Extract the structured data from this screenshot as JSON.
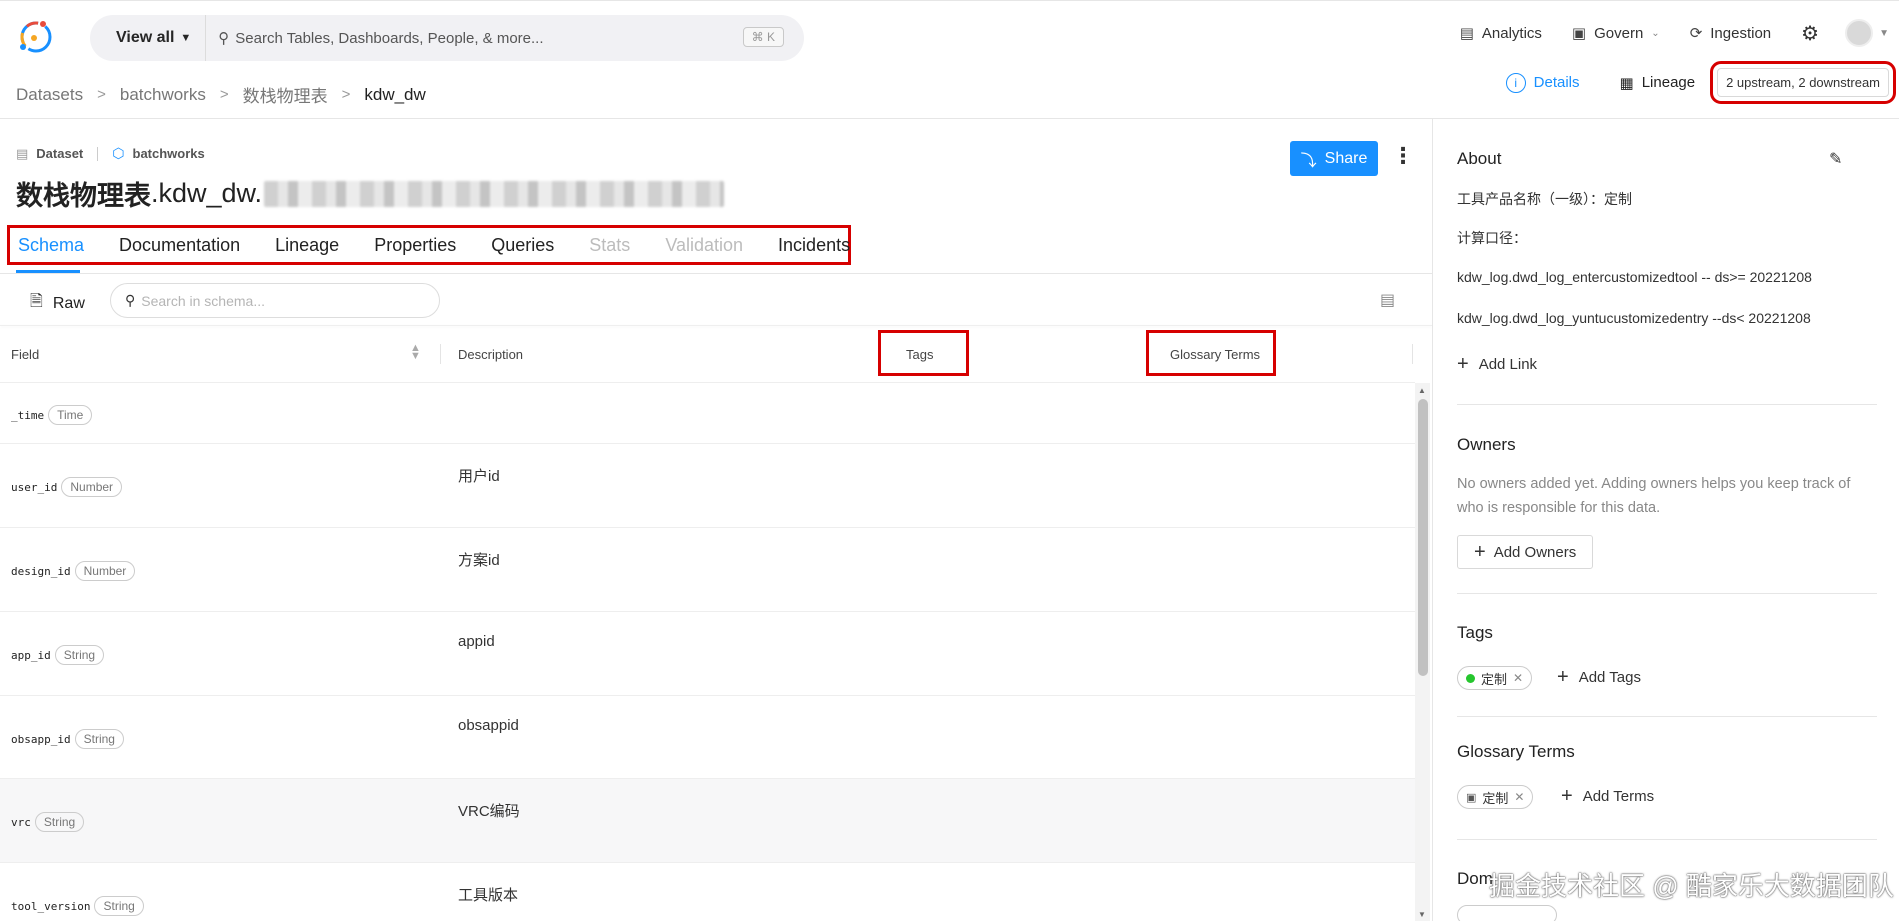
{
  "nav": {
    "view_all": "View all",
    "search_placeholder": "Search Tables, Dashboards, People, & more...",
    "shortcut": "⌘ K",
    "links": {
      "analytics": "Analytics",
      "govern": "Govern",
      "ingestion": "Ingestion"
    }
  },
  "breadcrumb": {
    "platform": "Datasets",
    "container": "batchworks",
    "schema": "数栈物理表",
    "current": "kdw_dw"
  },
  "detail_tabs": {
    "details": "Details",
    "lineage": "Lineage",
    "lineage_summary": "2 upstream, 2 downstream"
  },
  "entity": {
    "type": "Dataset",
    "container": "batchworks",
    "name_prefix": "数栈物理表",
    "name_suffix": ".kdw_dw.",
    "share": "Share"
  },
  "tabs": [
    "Schema",
    "Documentation",
    "Lineage",
    "Properties",
    "Queries",
    "Stats",
    "Validation",
    "Incidents"
  ],
  "schema_toolbar": {
    "raw": "Raw",
    "search_placeholder": "Search in schema..."
  },
  "table": {
    "headers": {
      "field": "Field",
      "description": "Description",
      "tags": "Tags",
      "glossary": "Glossary Terms"
    },
    "rows": [
      {
        "field": "_time",
        "type": "Time",
        "description": ""
      },
      {
        "field": "user_id",
        "type": "Number",
        "description": "用户id"
      },
      {
        "field": "design_id",
        "type": "Number",
        "description": "方案id"
      },
      {
        "field": "app_id",
        "type": "String",
        "description": "appid"
      },
      {
        "field": "obsapp_id",
        "type": "String",
        "description": "obsappid"
      },
      {
        "field": "vrc",
        "type": "String",
        "description": "VRC编码"
      },
      {
        "field": "tool_version",
        "type": "String",
        "description": "工具版本"
      }
    ]
  },
  "sidebar": {
    "about": {
      "title": "About",
      "line1": "工具产品名称（一级）：定制",
      "line2": "计算口径：",
      "line3": "kdw_log.dwd_log_entercustomizedtool  -- ds>= 20221208",
      "line4": "kdw_log.dwd_log_yuntucustomizedentry --ds< 20221208",
      "add_link": "Add Link"
    },
    "owners": {
      "title": "Owners",
      "empty": "No owners added yet. Adding owners helps you keep track of who is responsible for this data.",
      "add": "Add Owners"
    },
    "tags": {
      "title": "Tags",
      "chip": "定制",
      "add": "Add Tags"
    },
    "glossary": {
      "title": "Glossary Terms",
      "chip": "定制",
      "add": "Add Terms"
    },
    "domain": {
      "title": "Dom"
    }
  },
  "watermark": "掘金技术社区 @ 酷家乐大数据团队"
}
